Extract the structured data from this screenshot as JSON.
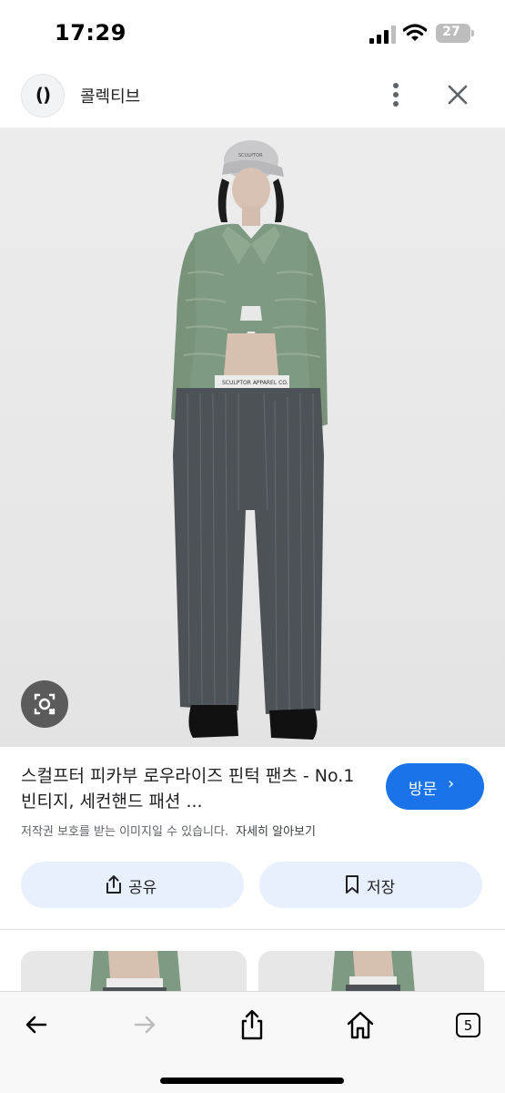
{
  "status_bar": {
    "time": "17:29",
    "battery": "27",
    "icons": [
      "cellular-signal-icon",
      "wifi-icon",
      "battery-icon"
    ]
  },
  "header": {
    "logo_text": "()",
    "site_name": "콜렉티브",
    "icons": [
      "more-vertical-icon",
      "close-icon"
    ]
  },
  "image": {
    "lens_icon": "camera-lens-icon",
    "cap_text": "SCULPTOR",
    "waistband_text": "SCULPTOR APPAREL CO."
  },
  "result": {
    "title": "스컬프터 피카부 로우라이즈 핀턱 팬츠 - No.1 빈티지, 세컨핸드 패션 ...",
    "visit_label": "방문",
    "visit_icon": "chevron-right-icon",
    "copyright": "저작권 보호를 받는 이미지일 수 있습니다.",
    "learn_more": "자세히 알아보기",
    "share_label": "공유",
    "share_icon": "share-icon",
    "save_label": "저장",
    "save_icon": "bookmark-icon"
  },
  "toolbar": {
    "tabs_count": "5",
    "icons": [
      "back-arrow-icon",
      "forward-arrow-icon",
      "share-icon",
      "home-icon",
      "tabs-icon"
    ]
  },
  "colors": {
    "accent": "#1a73e8",
    "button_bg": "#e8f0fe",
    "secondary_text": "#5f6368",
    "toolbar_bg": "#f8f8f8"
  }
}
